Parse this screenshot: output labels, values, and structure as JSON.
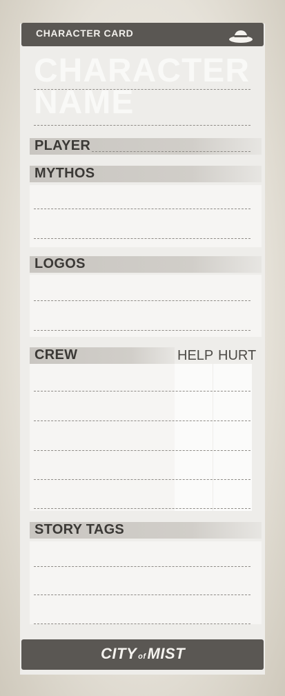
{
  "header": {
    "title": "CHARACTER CARD",
    "icon": "fedora-hat-icon"
  },
  "character_name_label": [
    "CHARACTER",
    "NAME"
  ],
  "sections": {
    "player": "PLAYER",
    "mythos": "MYTHOS",
    "logos": "LOGOS",
    "crew": "CREW",
    "crew_help": "HELP",
    "crew_hurt": "HURT",
    "story_tags": "STORY TAGS"
  },
  "footer": {
    "logo_part1": "CITY",
    "logo_part2": "of",
    "logo_part3": "MIST"
  },
  "colors": {
    "bar": "#5a5753",
    "label": "#3b3936",
    "paper": "#eeedea"
  }
}
